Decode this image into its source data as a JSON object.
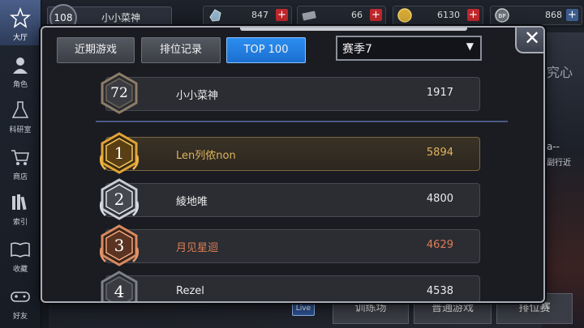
{
  "player": {
    "level": "108",
    "name": "小小菜神"
  },
  "resources": [
    {
      "icon": "crystal-icon",
      "value": "847"
    },
    {
      "icon": "ticket-icon",
      "value": "66"
    },
    {
      "icon": "coin-icon",
      "value": "6130"
    },
    {
      "icon": "bp-icon",
      "value": "868"
    }
  ],
  "sidebar": {
    "items": [
      {
        "label": "大厅",
        "icon": "hall-icon"
      },
      {
        "label": "角色",
        "icon": "character-icon"
      },
      {
        "label": "科研室",
        "icon": "lab-flask-icon"
      },
      {
        "label": "商店",
        "icon": "shop-cart-icon"
      },
      {
        "label": "索引",
        "icon": "index-books-icon"
      },
      {
        "label": "收藏",
        "icon": "collection-book-icon"
      },
      {
        "label": "好友",
        "icon": "friends-gamepad-icon"
      }
    ]
  },
  "background": {
    "live_badge": "Live",
    "right_text_1": "究心",
    "right_text_2": "a--",
    "right_text_3": "副行近",
    "bottom_buttons": [
      "训练场",
      "普通游戏",
      "排位赛"
    ]
  },
  "modal": {
    "tabs": [
      "近期游戏",
      "排位记录",
      "TOP 100"
    ],
    "active_tab": 2,
    "season": {
      "selected": "赛季7",
      "arrow": "▼"
    },
    "close": "✕",
    "self_row": {
      "rank": "72",
      "name": "小小菜神",
      "score": "1917"
    },
    "leaderboard": [
      {
        "rank": "1",
        "name": "Len列侬non",
        "score": "5894",
        "tier": "gold"
      },
      {
        "rank": "2",
        "name": "綾地唯",
        "score": "4800",
        "tier": "silver"
      },
      {
        "rank": "3",
        "name": "月见星迴",
        "score": "4629",
        "tier": "bronze"
      },
      {
        "rank": "4",
        "name": "Rezel",
        "score": "4538",
        "tier": "normal"
      }
    ]
  },
  "colors": {
    "gold": "#e0b45e",
    "silver": "#c9ccd3",
    "bronze": "#e07d55",
    "tab_active": "#1f7fe0",
    "badge_dark": "#4a4e57"
  }
}
